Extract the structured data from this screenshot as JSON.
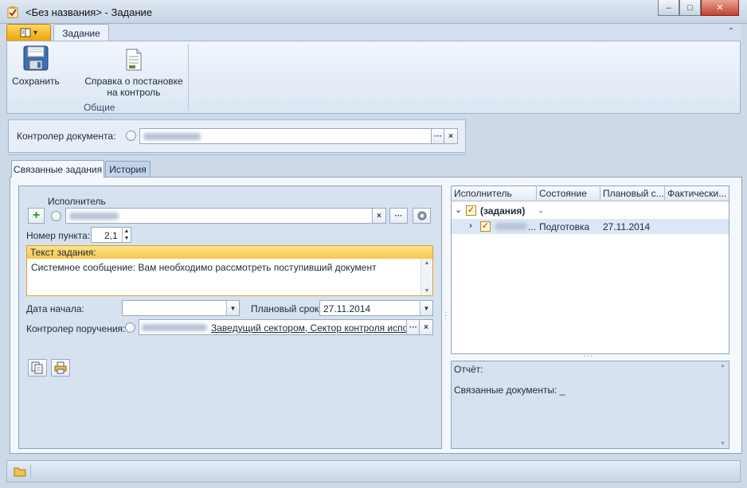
{
  "window": {
    "title": "<Без названия> - Задание",
    "minimize": "–",
    "maximize": "□",
    "close": "✕"
  },
  "ribbon": {
    "app_menu_glyph": "▾",
    "tab": "Задание",
    "collapse": "⌃",
    "buttons": {
      "save": "Сохранить",
      "report_line1": "Справка о постановке",
      "report_line2": "на контроль"
    },
    "group_label": "Общие"
  },
  "controller": {
    "label": "Контролер документа:",
    "clear": "×",
    "more": "···"
  },
  "tabs": [
    "Связанные задания",
    "История"
  ],
  "form": {
    "executor_label": "Исполнитель",
    "item_number_label": "Номер пункта:",
    "item_number_value": "2,1",
    "task_text_label": "Текст задания:",
    "task_text_value": "Системное сообщение:  Вам необходимо рассмотреть поступивший документ",
    "start_date_label": "Дата начала:",
    "start_date_value": "",
    "due_date_label": "Плановый срок:",
    "due_date_value": "27.11.2014",
    "task_controller_label": "Контролер поручения:",
    "task_controller_value": "Заведущий сектором, Сектор контроля испол",
    "clear": "×",
    "more": "···",
    "add": "+"
  },
  "grid": {
    "columns": [
      "Исполнитель",
      "Состояние",
      "Плановый с...",
      "Фактически..."
    ],
    "rows": [
      {
        "expander": "⌄",
        "executor": "(задания)",
        "state": "-",
        "planned": "",
        "actual": ""
      },
      {
        "expander": "›",
        "executor": "...",
        "state": "Подготовка",
        "planned": "27.11.2014",
        "actual": ""
      }
    ]
  },
  "report": {
    "label": "Отчёт:",
    "linked_docs": "Связанные документы: _"
  },
  "colors": {
    "accent_orange": "#f0a400",
    "task_header": "#f6c64e",
    "panel": "#d6e2f0"
  }
}
